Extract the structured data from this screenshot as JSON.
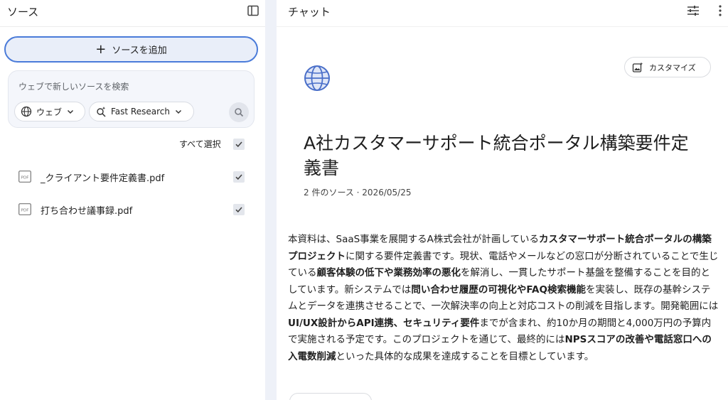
{
  "sources_panel": {
    "title": "ソース",
    "add_source_label": "ソースを追加",
    "search_placeholder": "ウェブで新しいソースを検索",
    "web_chip_label": "ウェブ",
    "research_chip_label": "Fast Research",
    "select_all_label": "すべて選択",
    "select_all_checked": true,
    "files": [
      {
        "name": "_クライアント要件定義書.pdf",
        "type": "PDF",
        "checked": true
      },
      {
        "name": "打ち合わせ議事録.pdf",
        "type": "PDF",
        "checked": true
      }
    ]
  },
  "chat_panel": {
    "title": "チャット",
    "customize_label": "カスタマイズ",
    "doc_title": "A社カスタマーサポート統合ポータル構築要件定義書",
    "doc_meta": "2 件のソース · 2026/05/25",
    "summary_segments": [
      {
        "text": "本資料は、SaaS事業を展開するA株式会社が計画している",
        "bold": false
      },
      {
        "text": "カスタマーサポート統合ポータルの構築プロジェクト",
        "bold": true
      },
      {
        "text": "に関する要件定義書です。現状、電話やメールなどの窓口が分断されていることで生じている",
        "bold": false
      },
      {
        "text": "顧客体験の低下や業務効率の悪化",
        "bold": true
      },
      {
        "text": "を解消し、一貫したサポート基盤を整備することを目的としています。新システムでは",
        "bold": false
      },
      {
        "text": "問い合わせ履歴の可視化やFAQ検索機能",
        "bold": true
      },
      {
        "text": "を実装し、既存の基幹システムとデータを連携させることで、一次解決率の向上と対応コストの削減を目指します。開発範囲には",
        "bold": false
      },
      {
        "text": "UI/UX設計からAPI連携、セキュリティ要件",
        "bold": true
      },
      {
        "text": "までが含まれ、約10か月の期間と4,000万円の予算内で実施される予定です。このプロジェクトを通じて、最終的には",
        "bold": false
      },
      {
        "text": "NPSスコアの改善や電話窓口への入電数削減",
        "bold": true
      },
      {
        "text": "といった具体的な成果を達成することを目標としています。",
        "bold": false
      }
    ]
  },
  "icons": {
    "panel_toggle": "side-panel-icon",
    "add": "plus-icon",
    "web": "globe-icon",
    "research": "sparkle-search-icon",
    "search": "search-icon",
    "pdf": "pdf-file-icon",
    "tune": "tune-icon",
    "more": "more-vert-icon",
    "doc_emoji": "globe-icon",
    "customize": "image-sparkle-icon"
  },
  "colors": {
    "accent_border": "#4a7bd9",
    "add_button_bg": "#e9eef9",
    "search_bg": "#f4f6fb",
    "gutter": "#eef1f8",
    "globe_blue": "#4a6fc9"
  }
}
